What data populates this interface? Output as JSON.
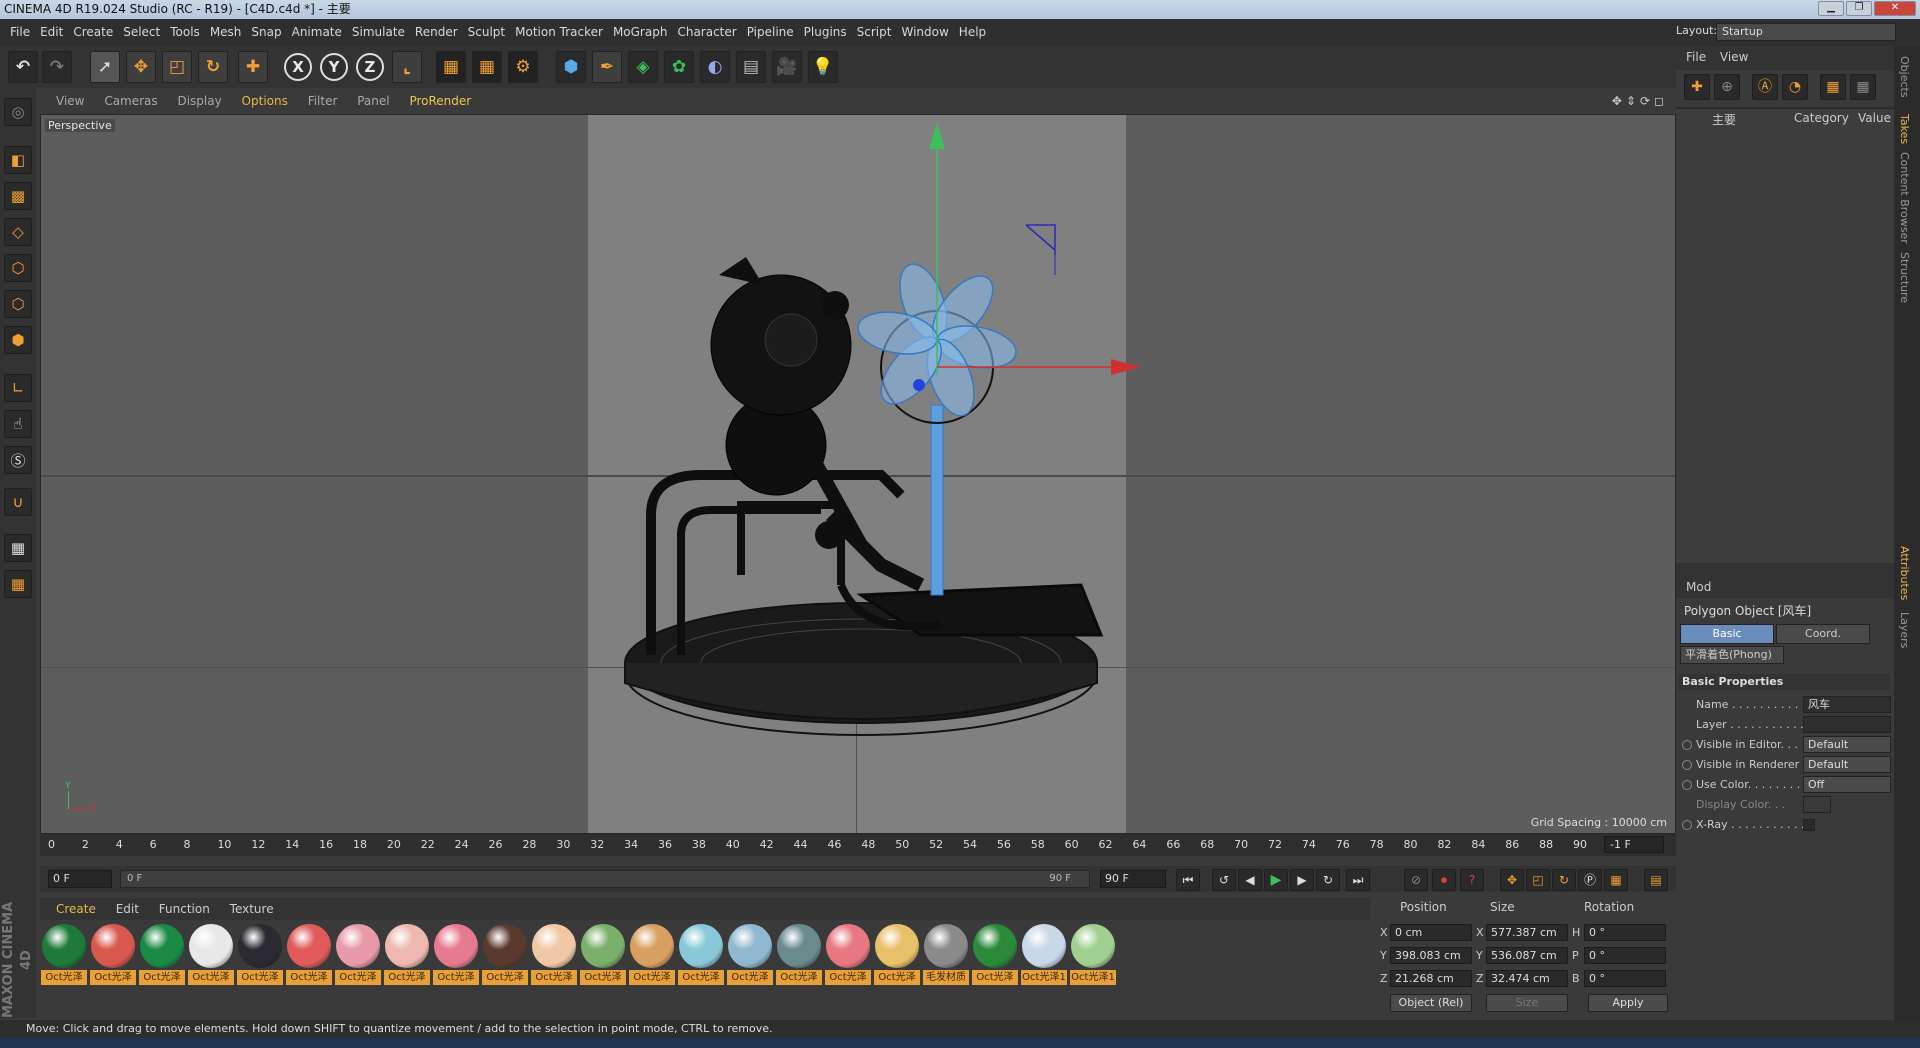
{
  "window": {
    "title": "CINEMA 4D R19.024 Studio (RC - R19) - [C4D.c4d *] - 主要"
  },
  "layout": {
    "label": "Layout:",
    "value": "Startup"
  },
  "menu": [
    "File",
    "Edit",
    "Create",
    "Select",
    "Tools",
    "Mesh",
    "Snap",
    "Animate",
    "Simulate",
    "Render",
    "Sculpt",
    "Motion Tracker",
    "MoGraph",
    "Character",
    "Pipeline",
    "Plugins",
    "Script",
    "Window",
    "Help"
  ],
  "toolbar_icons": [
    "undo-icon",
    "redo-icon",
    "select-icon",
    "move-icon",
    "scale-icon",
    "rotate-icon",
    "transform-icon",
    "x-axis-icon",
    "y-axis-icon",
    "z-axis-icon",
    "coordinate-system-icon",
    "render-view-icon",
    "render-picture-viewer-icon",
    "edit-render-settings-icon",
    "cube-icon",
    "pen-icon",
    "subdivision-icon",
    "mograph-cloner-icon",
    "deformer-icon",
    "floor-icon",
    "camera-icon",
    "light-icon"
  ],
  "axis_labels": [
    "X",
    "Y",
    "Z"
  ],
  "viewport": {
    "menu": [
      "View",
      "Cameras",
      "Display",
      "Options",
      "Filter",
      "Panel",
      "ProRender"
    ],
    "active_menu": "Options",
    "name": "Perspective",
    "grid_spacing": "Grid Spacing : 10000 cm"
  },
  "timeline": {
    "ticks": [
      "0",
      "2",
      "4",
      "6",
      "8",
      "10",
      "12",
      "14",
      "16",
      "18",
      "20",
      "22",
      "24",
      "26",
      "28",
      "30",
      "32",
      "34",
      "36",
      "38",
      "40",
      "42",
      "44",
      "46",
      "48",
      "50",
      "52",
      "54",
      "56",
      "58",
      "60",
      "62",
      "64",
      "66",
      "68",
      "70",
      "72",
      "74",
      "76",
      "78",
      "80",
      "82",
      "84",
      "86",
      "88",
      "90"
    ],
    "current": "-1 F",
    "start": "0 F",
    "slider_start": "0 F",
    "slider_end": "90 F",
    "end": "90 F"
  },
  "materials": {
    "menu": [
      "Create",
      "Edit",
      "Function",
      "Texture"
    ],
    "items": [
      {
        "label": "Oct光泽",
        "color": "#1e7a3a"
      },
      {
        "label": "Oct光泽",
        "color": "#d8584e"
      },
      {
        "label": "Oct光泽",
        "color": "#1a8a45"
      },
      {
        "label": "Oct光泽",
        "color": "#e8e8e8"
      },
      {
        "label": "Oct光泽",
        "color": "#2a2a30"
      },
      {
        "label": "Oct光泽",
        "color": "#e05a5a"
      },
      {
        "label": "Oct光泽",
        "color": "#e89aa8"
      },
      {
        "label": "Oct光泽",
        "color": "#eeb8b0"
      },
      {
        "label": "Oct光泽",
        "color": "#e87a90"
      },
      {
        "label": "Oct光泽",
        "color": "#5a3a2e"
      },
      {
        "label": "Oct光泽",
        "color": "#f0c8a8"
      },
      {
        "label": "Oct光泽",
        "color": "#7ab06a"
      },
      {
        "label": "Oct光泽",
        "color": "#d8a060"
      },
      {
        "label": "Oct光泽",
        "color": "#88c8d8"
      },
      {
        "label": "Oct光泽",
        "color": "#90b8d0"
      },
      {
        "label": "Oct光泽",
        "color": "#6a8a8e"
      },
      {
        "label": "Oct光泽",
        "color": "#e87880"
      },
      {
        "label": "Oct光泽",
        "color": "#e8c06a"
      },
      {
        "label": "毛发材质",
        "color": "#8a8a8a"
      },
      {
        "label": "Oct光泽",
        "color": "#2a8a3a"
      },
      {
        "label": "Oct光泽1",
        "color": "#c8d8e8"
      },
      {
        "label": "Oct光泽1",
        "color": "#a0d090"
      }
    ]
  },
  "coords": {
    "headers": [
      "Position",
      "Size",
      "Rotation"
    ],
    "rows": [
      {
        "axis": "X",
        "pos": "0 cm",
        "size_axis": "X",
        "size": "577.387 cm",
        "rot_axis": "H",
        "rot": "0 °"
      },
      {
        "axis": "Y",
        "pos": "398.083 cm",
        "size_axis": "Y",
        "size": "536.087 cm",
        "rot_axis": "P",
        "rot": "0 °"
      },
      {
        "axis": "Z",
        "pos": "21.268 cm",
        "size_axis": "Z",
        "size": "32.474 cm",
        "rot_axis": "B",
        "rot": "0 °"
      }
    ],
    "mode": "Object (Rel)",
    "size_mode": "Size",
    "apply": "Apply"
  },
  "status": "Move: Click and drag to move elements. Hold down SHIFT to quantize movement / add to the selection in point mode, CTRL to remove.",
  "brand": "MAXON CINEMA 4D",
  "takes": {
    "menu": [
      "File",
      "View"
    ],
    "item": "主要",
    "columns": [
      "Category",
      "Value"
    ]
  },
  "attributes": {
    "mode": "Mod",
    "object": "Polygon Object [风车]",
    "tabs": [
      "Basic",
      "Coord."
    ],
    "phong": "平滑着色(Phong)",
    "section": "Basic Properties",
    "props": [
      {
        "label": "Name . . . . . . . . . . .",
        "value": "风车",
        "kind": "field"
      },
      {
        "label": "Layer . . . . . . . . . . .",
        "value": "",
        "kind": "field"
      },
      {
        "label": "Visible in Editor. . .",
        "value": "Default",
        "kind": "btn"
      },
      {
        "label": "Visible in Renderer",
        "value": "Default",
        "kind": "btn"
      },
      {
        "label": "Use Color. . . . . . . .",
        "value": "Off",
        "kind": "btn"
      },
      {
        "label": "Display Color. . .",
        "value": "",
        "kind": "color"
      },
      {
        "label": "X-Ray . . . . . . . . . . .",
        "value": "",
        "kind": "check"
      }
    ]
  },
  "side_tabs": [
    "Objects",
    "Takes",
    "Content Browser",
    "Structure",
    "Attributes",
    "Layers"
  ]
}
